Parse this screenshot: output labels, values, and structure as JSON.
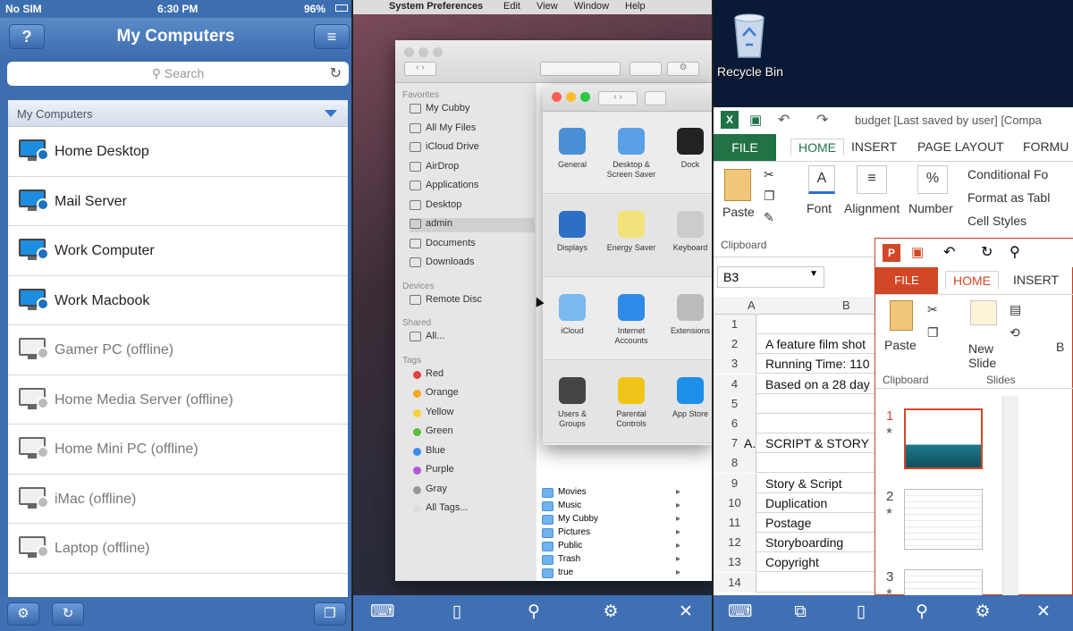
{
  "ios": {
    "status": {
      "carrier": "No SIM",
      "time": "6:30 PM",
      "battery": "96%"
    },
    "nav": {
      "help_label": "?",
      "title": "My Computers"
    },
    "search": {
      "placeholder": "Search"
    },
    "section": {
      "title": "My Computers"
    },
    "computers": [
      {
        "name": "Home Desktop",
        "online": true
      },
      {
        "name": "Mail Server",
        "online": true
      },
      {
        "name": "Work Computer",
        "online": true
      },
      {
        "name": "Work Macbook",
        "online": true
      },
      {
        "name": "Gamer PC (offline)",
        "online": false
      },
      {
        "name": "Home Media Server (offline)",
        "online": false
      },
      {
        "name": "Home Mini PC (offline)",
        "online": false
      },
      {
        "name": "iMac (offline)",
        "online": false
      },
      {
        "name": "Laptop (offline)",
        "online": false
      }
    ]
  },
  "mac": {
    "menu": [
      "System Preferences",
      "Edit",
      "View",
      "Window",
      "Help"
    ],
    "sidebar": {
      "favorites_header": "Favorites",
      "favorites": [
        "My Cubby",
        "All My Files",
        "iCloud Drive",
        "AirDrop",
        "Applications",
        "Desktop",
        "admin",
        "Documents",
        "Downloads"
      ],
      "devices_header": "Devices",
      "devices": [
        "Remote Disc"
      ],
      "shared_header": "Shared",
      "shared": [
        "All..."
      ],
      "tags_header": "Tags",
      "tags": [
        {
          "name": "Red",
          "color": "#e0443e"
        },
        {
          "name": "Orange",
          "color": "#f5a623"
        },
        {
          "name": "Yellow",
          "color": "#f7d23a"
        },
        {
          "name": "Green",
          "color": "#5bbd3f"
        },
        {
          "name": "Blue",
          "color": "#3b8beb"
        },
        {
          "name": "Purple",
          "color": "#b25ad6"
        },
        {
          "name": "Gray",
          "color": "#999999"
        },
        {
          "name": "All Tags...",
          "color": "#dddddd"
        }
      ]
    },
    "files": [
      "Movies",
      "Music",
      "My Cubby",
      "Pictures",
      "Public",
      "Trash",
      "true"
    ],
    "prefs": [
      {
        "label": "General",
        "color": "#4a8fd6"
      },
      {
        "label": "Desktop & Screen Saver",
        "color": "#5aa0e8"
      },
      {
        "label": "Dock",
        "color": "#222222"
      },
      {
        "label": "Displays",
        "color": "#2c6fc4"
      },
      {
        "label": "Energy Saver",
        "color": "#f2e27a"
      },
      {
        "label": "Keyboard",
        "color": "#cccccc"
      },
      {
        "label": "iCloud",
        "color": "#7ab8f0"
      },
      {
        "label": "Internet Accounts",
        "color": "#2d8ae6"
      },
      {
        "label": "Extensions",
        "color": "#bbbbbb"
      },
      {
        "label": "Users & Groups",
        "color": "#444444"
      },
      {
        "label": "Parental Controls",
        "color": "#f0c419"
      },
      {
        "label": "App Store",
        "color": "#1e8fe8"
      }
    ]
  },
  "desktop": {
    "recycle_bin": "Recycle Bin",
    "excel": {
      "title": "budget [Last saved by user] [Compa",
      "tabs": {
        "file": "FILE",
        "home": "HOME",
        "insert": "INSERT",
        "layout": "PAGE LAYOUT",
        "formulas": "FORMU"
      },
      "ribbon": {
        "paste": "Paste",
        "clipboard": "Clipboard",
        "font": "Font",
        "alignment": "Alignment",
        "number": "Number",
        "percent": "%",
        "cond": "Conditional Fo",
        "table": "Format as Tabl",
        "styles": "Cell Styles"
      },
      "namebox": "B3",
      "columns": [
        "A",
        "B"
      ],
      "rows": [
        {
          "n": "1",
          "a": "",
          "b": ""
        },
        {
          "n": "2",
          "a": "",
          "b": "A feature film shot"
        },
        {
          "n": "3",
          "a": "",
          "b": "Running Time: 110"
        },
        {
          "n": "4",
          "a": "",
          "b": "Based on a 28 day"
        },
        {
          "n": "5",
          "a": "",
          "b": ""
        },
        {
          "n": "6",
          "a": "",
          "b": ""
        },
        {
          "n": "7",
          "a": "A.",
          "b": "SCRIPT & STORY"
        },
        {
          "n": "8",
          "a": "",
          "b": ""
        },
        {
          "n": "9",
          "a": "",
          "b": "Story & Script"
        },
        {
          "n": "10",
          "a": "",
          "b": "Duplication"
        },
        {
          "n": "11",
          "a": "",
          "b": "Postage"
        },
        {
          "n": "12",
          "a": "",
          "b": "Storyboarding"
        },
        {
          "n": "13",
          "a": "",
          "b": "Copyright"
        },
        {
          "n": "14",
          "a": "",
          "b": ""
        }
      ]
    },
    "ppt": {
      "tabs": {
        "file": "FILE",
        "home": "HOME",
        "insert": "INSERT"
      },
      "ribbon": {
        "paste": "Paste",
        "new_slide": "New Slide",
        "clipboard": "Clipboard",
        "slides": "Slides",
        "b": "B"
      },
      "slides": [
        "1",
        "2",
        "3"
      ]
    }
  }
}
